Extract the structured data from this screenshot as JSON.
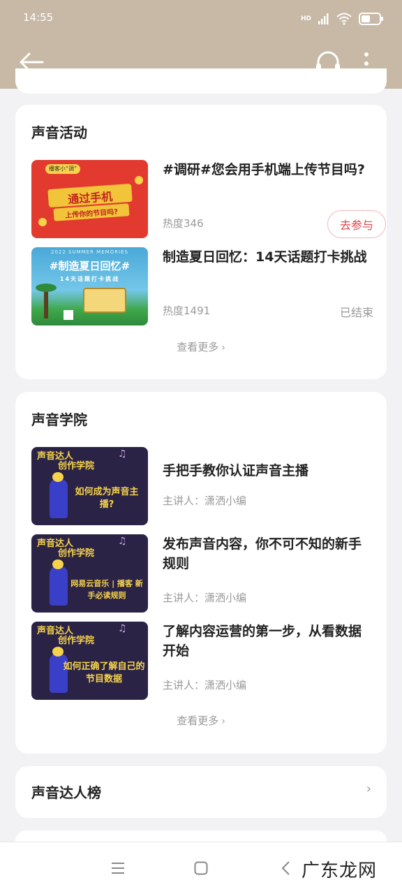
{
  "status": {
    "time": "14:55",
    "network": "HD"
  },
  "sections": {
    "activities": {
      "title": "声音活动",
      "items": [
        {
          "title": "#调研#您会用手机端上传节目吗?",
          "meta": "热度346",
          "action": "去参与",
          "thumb_text": "通过手机",
          "thumb_sub": "上传你的节目吗?",
          "thumb_badge": "播客小“调”"
        },
        {
          "title": "制造夏日回忆：14天话题打卡挑战",
          "meta": "热度1491",
          "status": "已结束",
          "thumb_text": "#制造夏日回忆#",
          "thumb_sub": "14天话题打卡挑战",
          "thumb_badge": "2022 SUMMER MEMORIES"
        }
      ],
      "see_more": "查看更多"
    },
    "academy": {
      "title": "声音学院",
      "items": [
        {
          "title": "手把手教你认证声音主播",
          "meta": "主讲人：潇洒小编",
          "thumb_head": "声音达人",
          "thumb_head2": "创作学院",
          "thumb_text": "如何成为声音主播?"
        },
        {
          "title": "发布声音内容，你不可不知的新手规则",
          "meta": "主讲人：潇洒小编",
          "thumb_head": "声音达人",
          "thumb_head2": "创作学院",
          "thumb_text": "网易云音乐 | 播客 新手必读规则"
        },
        {
          "title": "了解内容运营的第一步，从看数据开始",
          "meta": "主讲人：潇洒小编",
          "thumb_head": "声音达人",
          "thumb_head2": "创作学院",
          "thumb_text": "如何正确了解自己的节目数据"
        }
      ],
      "see_more": "查看更多"
    },
    "ranking": {
      "title": "声音达人榜"
    }
  },
  "watermark": "广东龙网",
  "colors": {
    "header": "#c7b9a6",
    "accent": "#e0464a",
    "background": "#f2f2f4"
  }
}
